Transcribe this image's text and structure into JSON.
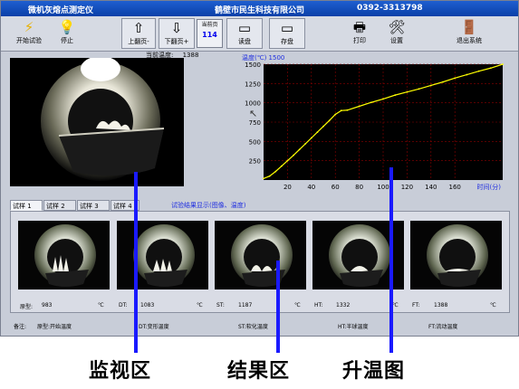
{
  "window": {
    "title": "微机灰熔点测定仪",
    "company": "鹤壁市民生科技有限公司",
    "phone": "0392-3313798"
  },
  "toolbar": {
    "start": "开始试验",
    "stop": "停止",
    "page_up": "上翻页-",
    "page_down": "下翻页+",
    "current_page_label": "当前页",
    "current_page": "114",
    "read": "读盘",
    "save": "存盘",
    "print": "打印",
    "settings": "设置",
    "exit": "退出系统"
  },
  "monitor": {
    "current_temp_label": "当前温度:",
    "current_temp_value": "1388"
  },
  "chart_data": {
    "type": "line",
    "title": "温度(℃) 1500",
    "xlabel": "时间(分)",
    "ylabel": "温度(℃)",
    "xlim": [
      0,
      200
    ],
    "ylim": [
      0,
      1500
    ],
    "x_ticks": [
      20,
      40,
      60,
      80,
      100,
      120,
      140,
      160
    ],
    "y_ticks": [
      250,
      500,
      750,
      1000,
      1250,
      1500
    ],
    "grid": true,
    "series": [
      {
        "color": "#ffff00",
        "x": [
          0,
          5,
          10,
          15,
          20,
          25,
          30,
          35,
          40,
          45,
          50,
          55,
          60,
          65,
          70,
          80,
          90,
          100,
          110,
          120,
          130,
          140,
          150,
          160,
          170,
          180,
          190,
          200
        ],
        "y": [
          20,
          50,
          110,
          180,
          250,
          320,
          395,
          470,
          545,
          620,
          695,
          770,
          850,
          900,
          905,
          955,
          1005,
          1050,
          1100,
          1140,
          1180,
          1225,
          1270,
          1320,
          1365,
          1410,
          1450,
          1500
        ]
      }
    ]
  },
  "tabs": [
    "试样 1",
    "试样 2",
    "试样 3",
    "试样 4"
  ],
  "results": {
    "title": "试验结果显示(图像、温度)",
    "unit": "℃",
    "items": [
      {
        "label": "原型:",
        "value": "983"
      },
      {
        "label": "DT:",
        "value": "1083"
      },
      {
        "label": "ST:",
        "value": "1187"
      },
      {
        "label": "HT:",
        "value": "1332"
      },
      {
        "label": "FT:",
        "value": "1388"
      }
    ]
  },
  "notes": {
    "prefix": "备注:",
    "items": [
      "原型:开始温度",
      "DT:变形温度",
      "ST:软化温度",
      "HT:半球温度",
      "FT:流动温度"
    ]
  },
  "annotations": {
    "monitor": "监视区",
    "results": "结果区",
    "chart": "升温图",
    "pointer_color": "#1a1aff"
  }
}
